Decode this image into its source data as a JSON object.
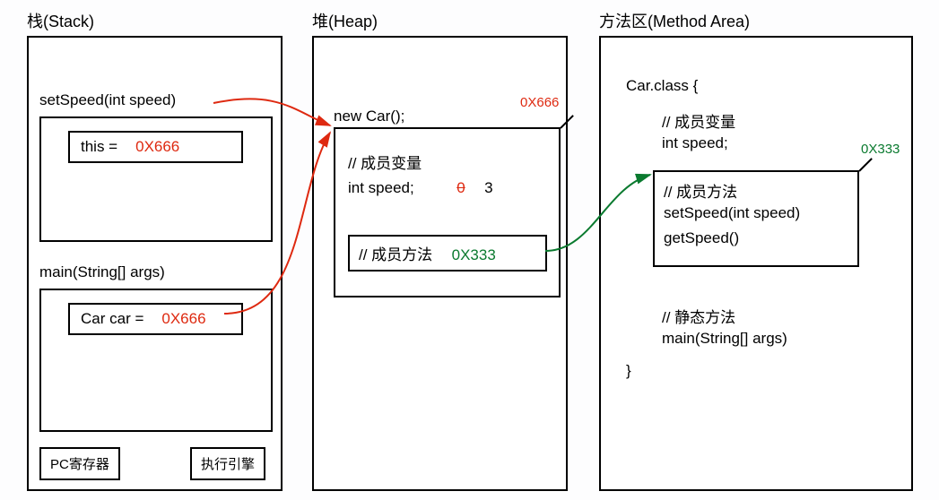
{
  "columns": {
    "stack": {
      "title": "栈(Stack)"
    },
    "heap": {
      "title": "堆(Heap)"
    },
    "methodArea": {
      "title": "方法区(Method Area)"
    }
  },
  "stack": {
    "frame1": {
      "title": "setSpeed(int speed)",
      "var": "this =",
      "val": "0X666"
    },
    "frame2": {
      "title": "main(String[] args)",
      "var": "Car car =",
      "val": "0X666"
    },
    "pcRegister": "PC寄存器",
    "execEngine": "执行引擎"
  },
  "heap": {
    "newCar": "new Car();",
    "addrLabel": "0X666",
    "commentVar": "// 成员变量",
    "intSpeed": "int speed;",
    "oldVal": "0",
    "newVal": "3",
    "methodBox": {
      "comment": "// 成员方法",
      "addr": "0X333"
    }
  },
  "methodArea": {
    "classDecl": "Car.class {",
    "commentVar": "// 成员变量",
    "intSpeed": "int speed;",
    "addrLabel": "0X333",
    "methodsBox": {
      "comment": "// 成员方法",
      "set": "setSpeed(int speed)",
      "get": "getSpeed()"
    },
    "commentStatic": "// 静态方法",
    "mainMethod": "main(String[] args)",
    "closeBrace": "}"
  }
}
